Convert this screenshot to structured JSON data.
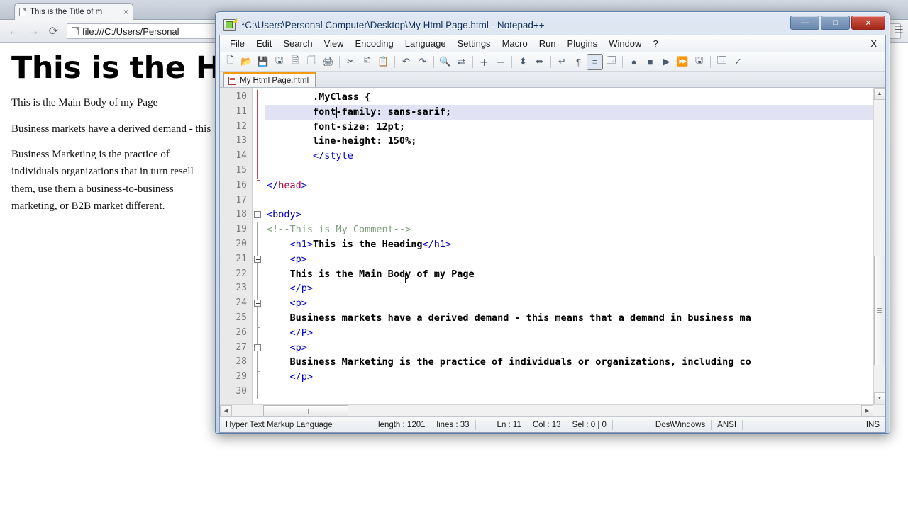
{
  "browser": {
    "tab": {
      "title": "This is the Title of m",
      "close_label": "×",
      "favicon": "page-icon"
    },
    "nav": {
      "back": "←",
      "forward": "→",
      "reload": "⟳",
      "menu": "☰"
    },
    "url": "file:///C:/Users/Personal",
    "page": {
      "heading": "This is the He",
      "paragraphs": [
        "This is the Main Body of my Page",
        "Business markets have a derived demand - this",
        "Business Marketing is the practice of individuals organizations that in turn resell them, use them a business-to-business marketing, or B2B market different."
      ]
    }
  },
  "notepad": {
    "title": "*C:\\Users\\Personal Computer\\Desktop\\My Html Page.html - Notepad++",
    "window_buttons": {
      "minimize": "—",
      "maximize": "□",
      "close": "✕"
    },
    "menu": [
      "File",
      "Edit",
      "Search",
      "View",
      "Encoding",
      "Language",
      "Settings",
      "Macro",
      "Run",
      "Plugins",
      "Window",
      "?"
    ],
    "menu_close": "X",
    "toolbar": [
      {
        "name": "new-file-icon",
        "glyph": "🗋"
      },
      {
        "name": "open-file-icon",
        "glyph": "📂"
      },
      {
        "name": "save-icon",
        "glyph": "💾"
      },
      {
        "name": "save-all-icon",
        "glyph": "🖫"
      },
      {
        "name": "close-file-icon",
        "glyph": "🗎"
      },
      {
        "name": "close-all-files-icon",
        "glyph": "🗍"
      },
      {
        "name": "print-icon",
        "glyph": "🖨"
      },
      {
        "sep": true
      },
      {
        "name": "cut-icon",
        "glyph": "✂"
      },
      {
        "name": "copy-icon",
        "glyph": "🗈"
      },
      {
        "name": "paste-icon",
        "glyph": "📋"
      },
      {
        "sep": true
      },
      {
        "name": "undo-icon",
        "glyph": "↶"
      },
      {
        "name": "redo-icon",
        "glyph": "↷"
      },
      {
        "sep": true
      },
      {
        "name": "find-icon",
        "glyph": "🔍"
      },
      {
        "name": "replace-icon",
        "glyph": "⇄"
      },
      {
        "sep": true
      },
      {
        "name": "zoom-in-icon",
        "glyph": "＋"
      },
      {
        "name": "zoom-out-icon",
        "glyph": "－"
      },
      {
        "sep": true
      },
      {
        "name": "sync-vertical-scroll-icon",
        "glyph": "⬍"
      },
      {
        "name": "sync-horizontal-scroll-icon",
        "glyph": "⬌"
      },
      {
        "sep": true
      },
      {
        "name": "word-wrap-icon",
        "glyph": "↵"
      },
      {
        "name": "show-all-characters-icon",
        "glyph": "¶"
      },
      {
        "name": "indent-guide-icon",
        "glyph": "≡",
        "active": true
      },
      {
        "name": "user-defined-dialog-icon",
        "glyph": "🗔"
      },
      {
        "sep": true
      },
      {
        "name": "macro-record-icon",
        "glyph": "●"
      },
      {
        "name": "macro-stop-icon",
        "glyph": "■"
      },
      {
        "name": "macro-play-icon",
        "glyph": "▶"
      },
      {
        "name": "macro-playback-multiple-icon",
        "glyph": "⏩"
      },
      {
        "name": "macro-save-icon",
        "glyph": "🖫"
      },
      {
        "sep": true
      },
      {
        "name": "run-icon",
        "glyph": "🗔"
      },
      {
        "name": "spell-check-icon",
        "glyph": "✓"
      }
    ],
    "document_tab": {
      "label": "My Html Page.html",
      "icon": "html-file-icon"
    },
    "code": {
      "first_line": 10,
      "highlighted_line": 11,
      "lines": [
        {
          "n": 10,
          "fold": "none",
          "guide": "red-start",
          "segments": [
            {
              "t": "        .MyClass {",
              "c": "css"
            }
          ]
        },
        {
          "n": 11,
          "fold": "none",
          "guide": "red",
          "segments": [
            {
              "t": "        font-family: sans-sarif;",
              "c": "css"
            }
          ]
        },
        {
          "n": 12,
          "fold": "none",
          "guide": "red",
          "segments": [
            {
              "t": "        font-size: 12pt;",
              "c": "css"
            }
          ]
        },
        {
          "n": 13,
          "fold": "none",
          "guide": "red",
          "segments": [
            {
              "t": "        line-height: 150%;",
              "c": "css"
            }
          ]
        },
        {
          "n": 14,
          "fold": "none",
          "guide": "red",
          "segments": [
            {
              "t": "        ",
              "c": "css"
            },
            {
              "t": "</style",
              "c": "tg"
            }
          ]
        },
        {
          "n": 15,
          "fold": "none",
          "guide": "red",
          "segments": [
            {
              "t": "",
              "c": "css"
            }
          ]
        },
        {
          "n": 16,
          "fold": "end-red",
          "guide": "none",
          "segments": [
            {
              "t": "</",
              "c": "tg"
            },
            {
              "t": "head",
              "c": "tgname"
            },
            {
              "t": ">",
              "c": "tg"
            }
          ]
        },
        {
          "n": 17,
          "fold": "none",
          "guide": "none",
          "segments": [
            {
              "t": "",
              "c": "css"
            }
          ]
        },
        {
          "n": 18,
          "fold": "box",
          "guide": "none",
          "segments": [
            {
              "t": "<body>",
              "c": "tg"
            }
          ]
        },
        {
          "n": 19,
          "fold": "none",
          "guide": "line",
          "segments": [
            {
              "t": "<!--This is My Comment-->",
              "c": "cmt"
            }
          ]
        },
        {
          "n": 20,
          "fold": "none",
          "guide": "line",
          "segments": [
            {
              "t": "    ",
              "c": "css"
            },
            {
              "t": "<h1>",
              "c": "tg"
            },
            {
              "t": "This is the Heading",
              "c": "txt"
            },
            {
              "t": "</h1>",
              "c": "tg"
            }
          ]
        },
        {
          "n": 21,
          "fold": "box",
          "guide": "line",
          "segments": [
            {
              "t": "    ",
              "c": "css"
            },
            {
              "t": "<p>",
              "c": "tg"
            }
          ]
        },
        {
          "n": 22,
          "fold": "none",
          "guide": "line",
          "segments": [
            {
              "t": "    ",
              "c": "css"
            },
            {
              "t": "This is the Main Body of my Page",
              "c": "txt"
            }
          ]
        },
        {
          "n": 23,
          "fold": "end",
          "guide": "line",
          "segments": [
            {
              "t": "    ",
              "c": "css"
            },
            {
              "t": "</p>",
              "c": "tg"
            }
          ]
        },
        {
          "n": 24,
          "fold": "box",
          "guide": "line",
          "segments": [
            {
              "t": "    ",
              "c": "css"
            },
            {
              "t": "<p>",
              "c": "tg"
            }
          ]
        },
        {
          "n": 25,
          "fold": "none",
          "guide": "line",
          "segments": [
            {
              "t": "    ",
              "c": "css"
            },
            {
              "t": "Business markets have a derived demand - this means that a demand in business ma",
              "c": "txt"
            }
          ]
        },
        {
          "n": 26,
          "fold": "end",
          "guide": "line",
          "segments": [
            {
              "t": "    ",
              "c": "css"
            },
            {
              "t": "</P>",
              "c": "tg"
            }
          ]
        },
        {
          "n": 27,
          "fold": "box",
          "guide": "line",
          "segments": [
            {
              "t": "    ",
              "c": "css"
            },
            {
              "t": "<p>",
              "c": "tg"
            }
          ]
        },
        {
          "n": 28,
          "fold": "none",
          "guide": "line",
          "segments": [
            {
              "t": "    ",
              "c": "css"
            },
            {
              "t": "Business Marketing is the practice of individuals or organizations, including co",
              "c": "txt"
            }
          ]
        },
        {
          "n": 29,
          "fold": "end",
          "guide": "line",
          "segments": [
            {
              "t": "    ",
              "c": "css"
            },
            {
              "t": "</p>",
              "c": "tg"
            }
          ]
        },
        {
          "n": 30,
          "fold": "none",
          "guide": "line",
          "segments": [
            {
              "t": "",
              "c": "css"
            }
          ]
        }
      ]
    },
    "scroll": {
      "up_arrow": "▲",
      "down_arrow": "▼",
      "left_arrow": "◀",
      "right_arrow": "▶"
    },
    "status": {
      "language": "Hyper Text Markup Language",
      "length_label": "length : 1201",
      "lines_label": "lines : 33",
      "ln": "Ln : 11",
      "col": "Col : 13",
      "sel": "Sel : 0 | 0",
      "eol": "Dos\\Windows",
      "encoding": "ANSI",
      "insert_mode": "INS"
    }
  }
}
